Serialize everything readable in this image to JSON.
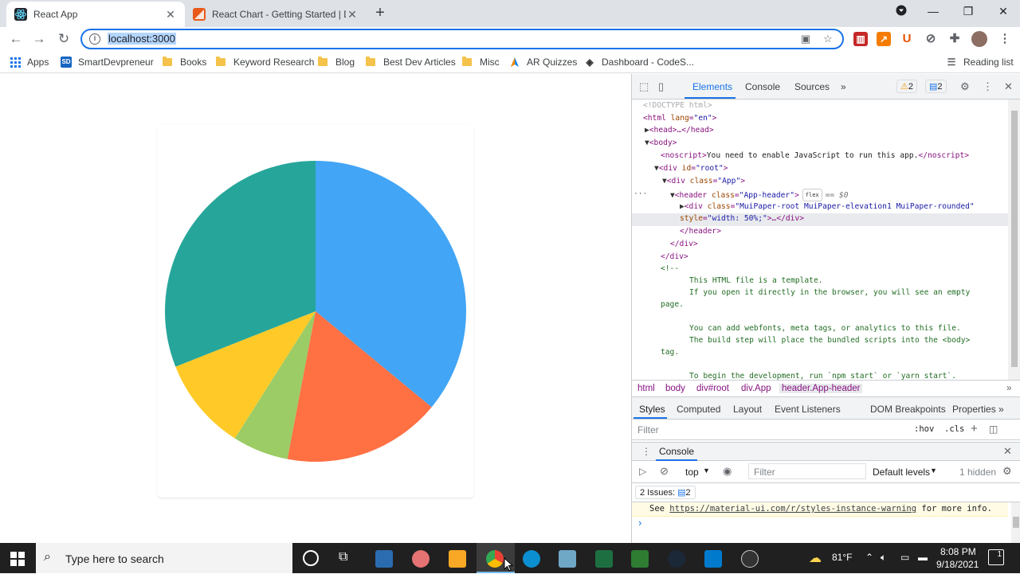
{
  "browser": {
    "tabs": [
      {
        "title": "React App",
        "active": true
      },
      {
        "title": "React Chart - Getting Started | De",
        "active": false
      }
    ],
    "address": "localhost:3000",
    "bookmarks": [
      {
        "label": "Apps"
      },
      {
        "label": "SmartDevpreneur"
      },
      {
        "label": "Books"
      },
      {
        "label": "Keyword Research"
      },
      {
        "label": "Blog"
      },
      {
        "label": "Best Dev Articles"
      },
      {
        "label": "Misc"
      },
      {
        "label": "AR Quizzes"
      },
      {
        "label": "Dashboard - CodeS..."
      }
    ],
    "reading_list": "Reading list",
    "ext_letters": {
      "sd": "SD",
      "u": "U"
    }
  },
  "page": {
    "chart_data": {
      "type": "pie",
      "values": [
        36,
        17,
        6,
        10,
        31
      ],
      "colors": [
        "#42a5f5",
        "#ff7043",
        "#9ccc65",
        "#ffca28",
        "#26a69a"
      ]
    }
  },
  "devtools": {
    "tabs": [
      "Elements",
      "Console",
      "Sources"
    ],
    "more": "»",
    "warn_count": "2",
    "msg_count": "2",
    "dom": {
      "l1": "<!DOCTYPE html>",
      "l2_open": "<html ",
      "l2_attr": "lang",
      "l2_val": "\"en\"",
      "l2_close": ">",
      "l3": "<head>…</head>",
      "l4": "<body>",
      "l5_open": "<noscript>",
      "l5_text": "You need to enable JavaScript to run this app.",
      "l5_close": "</noscript>",
      "l6_open": "<div ",
      "l6_attr": "id",
      "l6_val": "\"root\"",
      "l6_close": ">",
      "l7_open": "<div ",
      "l7_attr": "class",
      "l7_val": "\"App\"",
      "l7_close": ">",
      "l8_open": "<header ",
      "l8_attr": "class",
      "l8_val": "\"App-header\"",
      "l8_close": ">",
      "l8_badge": "flex",
      "l8_eq": "== $0",
      "l9_open": "<div ",
      "l9_attr": "class",
      "l9_val": "\"MuiPaper-root MuiPaper-elevation1 MuiPaper-rounded\"",
      "l10_attr": "style",
      "l10_val": "\"width: 50%;\"",
      "l10_close": ">…</div>",
      "l11": "</header>",
      "l12": "</div>",
      "l13": "</div>",
      "l14": "<!--",
      "l15": "This HTML file is a template.",
      "l16": "If you open it directly in the browser, you will see an empty",
      "l17": "page.",
      "l18": "You can add webfonts, meta tags, or analytics to this file.",
      "l19": "The build step will place the bundled scripts into the <body>",
      "l20": "tag.",
      "l21": "To begin the development, run `npm start` or `yarn start`."
    },
    "breadcrumbs": [
      "html",
      "body",
      "div#root",
      "div.App",
      "header.App-header"
    ],
    "subtabs": [
      "Styles",
      "Computed",
      "Layout",
      "Event Listeners",
      "DOM Breakpoints",
      "Properties"
    ],
    "filter_placeholder": "Filter",
    "hov": ":hov",
    "cls": ".cls",
    "drawer_title": "Console",
    "context": "top",
    "console_filter": "Filter",
    "levels": "Default levels",
    "hidden": "1 hidden",
    "issues_label": "2 Issues:",
    "issues_count": "2",
    "warn_prefix": "See ",
    "warn_link": "https://material-ui.com/r/styles-instance-warning",
    "warn_suffix": " for more info.",
    "prompt": "›"
  },
  "taskbar": {
    "search_placeholder": "Type here to search",
    "temperature": "81°F",
    "time": "8:08 PM",
    "date": "9/18/2021",
    "notifications": "1"
  }
}
